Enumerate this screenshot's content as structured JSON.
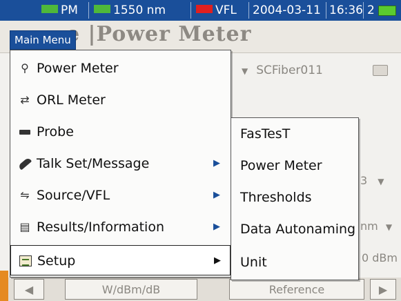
{
  "status": {
    "mode": "PM",
    "wavelength": "1550 nm",
    "vfl": "VFL",
    "date": "2004-03-11",
    "time": "16:36",
    "slot": "2",
    "colors": {
      "mode_square": "#4fb83a",
      "wavelength_square": "#4fb83a",
      "vfl_square": "#e02020",
      "battery": "#5acb2f"
    }
  },
  "page": {
    "title_partial": "e  |Power Meter",
    "fiber_dropdown": "SCFiber011",
    "side_values": [
      "3",
      "nm",
      "0 dBm"
    ]
  },
  "bottom_bar": {
    "left_arrow": "◀",
    "units_button": "W/dBm/dB",
    "reference_button": "Reference",
    "right_arrow": "▶"
  },
  "main_menu": {
    "tab_label": "Main Menu",
    "items": [
      {
        "label": "Power Meter",
        "icon": "power-meter-icon",
        "has_submenu": false
      },
      {
        "label": "ORL Meter",
        "icon": "orl-meter-icon",
        "has_submenu": false
      },
      {
        "label": "Probe",
        "icon": "probe-icon",
        "has_submenu": false
      },
      {
        "label": "Talk Set/Message",
        "icon": "phone-icon",
        "has_submenu": true
      },
      {
        "label": "Source/VFL",
        "icon": "source-vfl-icon",
        "has_submenu": true
      },
      {
        "label": "Results/Information",
        "icon": "results-info-icon",
        "has_submenu": true
      },
      {
        "label": "Setup",
        "icon": "setup-icon",
        "has_submenu": true,
        "selected": true
      }
    ]
  },
  "setup_submenu": {
    "items": [
      "FasTesT",
      "Power Meter",
      "Thresholds",
      "Data Autonaming",
      "Unit"
    ]
  }
}
